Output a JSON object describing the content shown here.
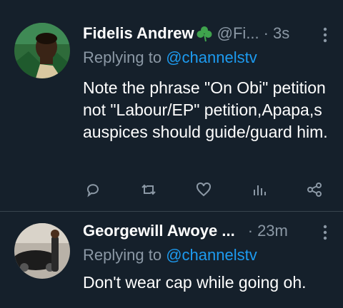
{
  "tweets": [
    {
      "name": "Fidelis Andrew",
      "handle": "@Fi...",
      "separator": "·",
      "time": "3s",
      "reply_prefix": "Replying to",
      "reply_to": "@channelstv",
      "text": "Note the phrase \"On Obi\" petition not \"Labour/EP\" petition,Apapa,s auspices should guide/guard him."
    },
    {
      "name": "Georgewill Awoye ...",
      "separator": "·",
      "time": "23m",
      "reply_prefix": "Replying to",
      "reply_to": "@channelstv",
      "text": "Don't wear cap while going oh."
    }
  ],
  "colors": {
    "background": "#15202b",
    "secondary_text": "#8b98a5",
    "link": "#1d9bf0",
    "divider": "#38444d"
  },
  "icons": [
    "clover-icon",
    "more-icon",
    "reply-icon",
    "retweet-icon",
    "like-icon",
    "analytics-icon",
    "share-icon"
  ]
}
